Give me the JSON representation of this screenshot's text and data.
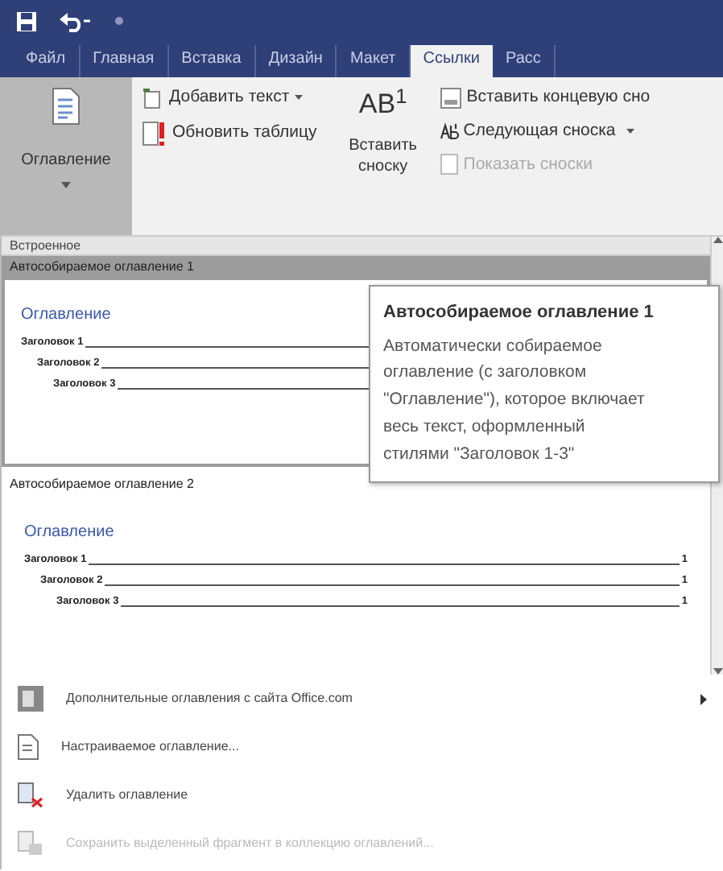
{
  "tabs": [
    {
      "label": "Файл",
      "selected": false
    },
    {
      "label": "Главная",
      "selected": false
    },
    {
      "label": "Вставка",
      "selected": false
    },
    {
      "label": "Дизайн",
      "selected": false
    },
    {
      "label": "Макет",
      "selected": false
    },
    {
      "label": "Ссылки",
      "selected": true
    },
    {
      "label": "Расс",
      "selected": false
    }
  ],
  "ribbon": {
    "toc_button": {
      "label": "Оглавление",
      "pressed": true
    },
    "toc_commands": [
      {
        "label": "Добавить текст",
        "kind": "add",
        "dropdown": true
      },
      {
        "label": "Обновить таблицу",
        "kind": "update",
        "dropdown": false
      }
    ],
    "footnote_button": {
      "icon_text": "AB$^{1}$",
      "label": "Вставить сноску"
    },
    "footnote_commands": [
      {
        "label": "Вставить концевую сно",
        "kind": "endnote",
        "dropdown": false,
        "disabled": false
      },
      {
        "label": "Следующая сноска",
        "kind": "next",
        "dropdown": true,
        "disabled": false
      },
      {
        "label": "Показать сноски",
        "kind": "show",
        "dropdown": false,
        "disabled": true
      }
    ]
  },
  "gallery": {
    "section": "Встроенное",
    "items": [
      {
        "title": "Автособираемое оглавление 1",
        "selected": true,
        "heading": "Оглавление",
        "entries": [
          {
            "text": "Заголовок 1",
            "children": [
              {
                "text": "Заголовок 2",
                "children": [
                  {
                    "text": "Заголовок 3"
                  }
                ]
              }
            ]
          }
        ]
      },
      {
        "title": "Автособираемое оглавление 2",
        "selected": false,
        "heading": "Оглавление",
        "entries": [
          {
            "text": "Заголовок 1",
            "page": "1",
            "children": [
              {
                "text": "Заголовок 2",
                "page": "1",
                "children": [
                  {
                    "text": "Заголовок 3",
                    "page": "1"
                  }
                ]
              }
            ]
          }
        ]
      }
    ]
  },
  "tooltip": {
    "title": "Автособираемое оглавление 1",
    "text": "Автоматически собираемое оглавление (с заголовком \"Оглавление\"), которое включает весь текст, оформленный стилями \"Заголовок 1-3\""
  },
  "menu": [
    {
      "label": "Дополнительные оглавления с сайта Office.com",
      "kind": "web",
      "submenu": true,
      "disabled": false
    },
    {
      "label": "Настраиваемое оглавление...",
      "kind": "custom",
      "submenu": false,
      "disabled": false
    },
    {
      "label": "Удалить оглавление",
      "kind": "remove",
      "submenu": false,
      "disabled": false
    },
    {
      "label": "Сохранить выделенный фрагмент в коллекцию оглавлений...",
      "kind": "save",
      "submenu": false,
      "disabled": true
    }
  ]
}
